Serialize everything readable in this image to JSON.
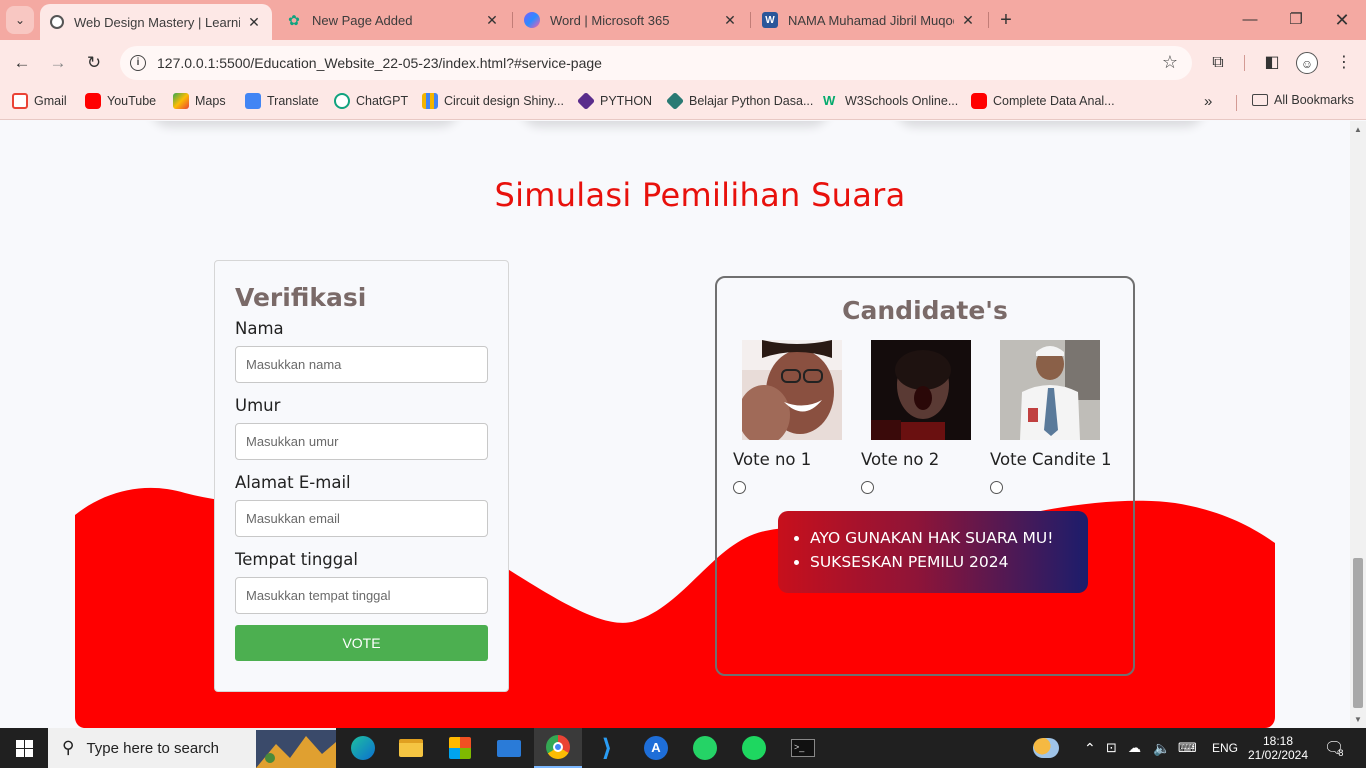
{
  "browser": {
    "tabs": [
      {
        "title": "Web Design Mastery | Learning",
        "active": true
      },
      {
        "title": "New Page Added",
        "active": false
      },
      {
        "title": "Word | Microsoft 365",
        "active": false
      },
      {
        "title": "NAMA Muhamad Jibril Muqoda",
        "active": false
      }
    ],
    "url": "127.0.0.1:5500/Education_Website_22-05-23/index.html?#service-page",
    "bookmarks": [
      {
        "label": "Gmail",
        "color": "#ea4335"
      },
      {
        "label": "YouTube",
        "color": "#ff0000"
      },
      {
        "label": "Maps",
        "color": "#34a853"
      },
      {
        "label": "Translate",
        "color": "#4285f4"
      },
      {
        "label": "ChatGPT",
        "color": "#10a37f"
      },
      {
        "label": "Circuit design Shiny...",
        "color": "#f4b400"
      },
      {
        "label": "PYTHON",
        "color": "#5a2d8c"
      },
      {
        "label": "Belajar Python Dasa...",
        "color": "#2a7a74"
      },
      {
        "label": "W3Schools Online...",
        "color": "#04aa6d"
      },
      {
        "label": "Complete Data Anal...",
        "color": "#ff0000"
      }
    ],
    "all_bookmarks": "All Bookmarks"
  },
  "page": {
    "section_title": "Simulasi Pemilihan Suara",
    "verification": {
      "title": "Verifikasi",
      "fields": [
        {
          "label": "Nama",
          "placeholder": "Masukkan nama"
        },
        {
          "label": "Umur",
          "placeholder": "Masukkan umur"
        },
        {
          "label": "Alamat E-mail",
          "placeholder": "Masukkan email"
        },
        {
          "label": "Tempat tinggal",
          "placeholder": "Masukkan tempat tinggal"
        }
      ],
      "submit_label": "VOTE"
    },
    "candidates": {
      "title": "Candidate's",
      "items": [
        {
          "label": "Vote no 1"
        },
        {
          "label": "Vote no 2"
        },
        {
          "label": "Vote Candite 1"
        }
      ]
    },
    "slogans": [
      "AYO GUNAKAN HAK SUARA MU!",
      "SUKSESKAN PEMILU 2024"
    ],
    "colors": {
      "title": "#e8110c",
      "wave": "#ff0000",
      "vote_button": "#4caf50",
      "heading": "#7a6a68"
    }
  },
  "taskbar": {
    "search_placeholder": "Type here to search",
    "language": "ENG",
    "time": "18:18",
    "date": "21/02/2024",
    "notifications": "8"
  }
}
